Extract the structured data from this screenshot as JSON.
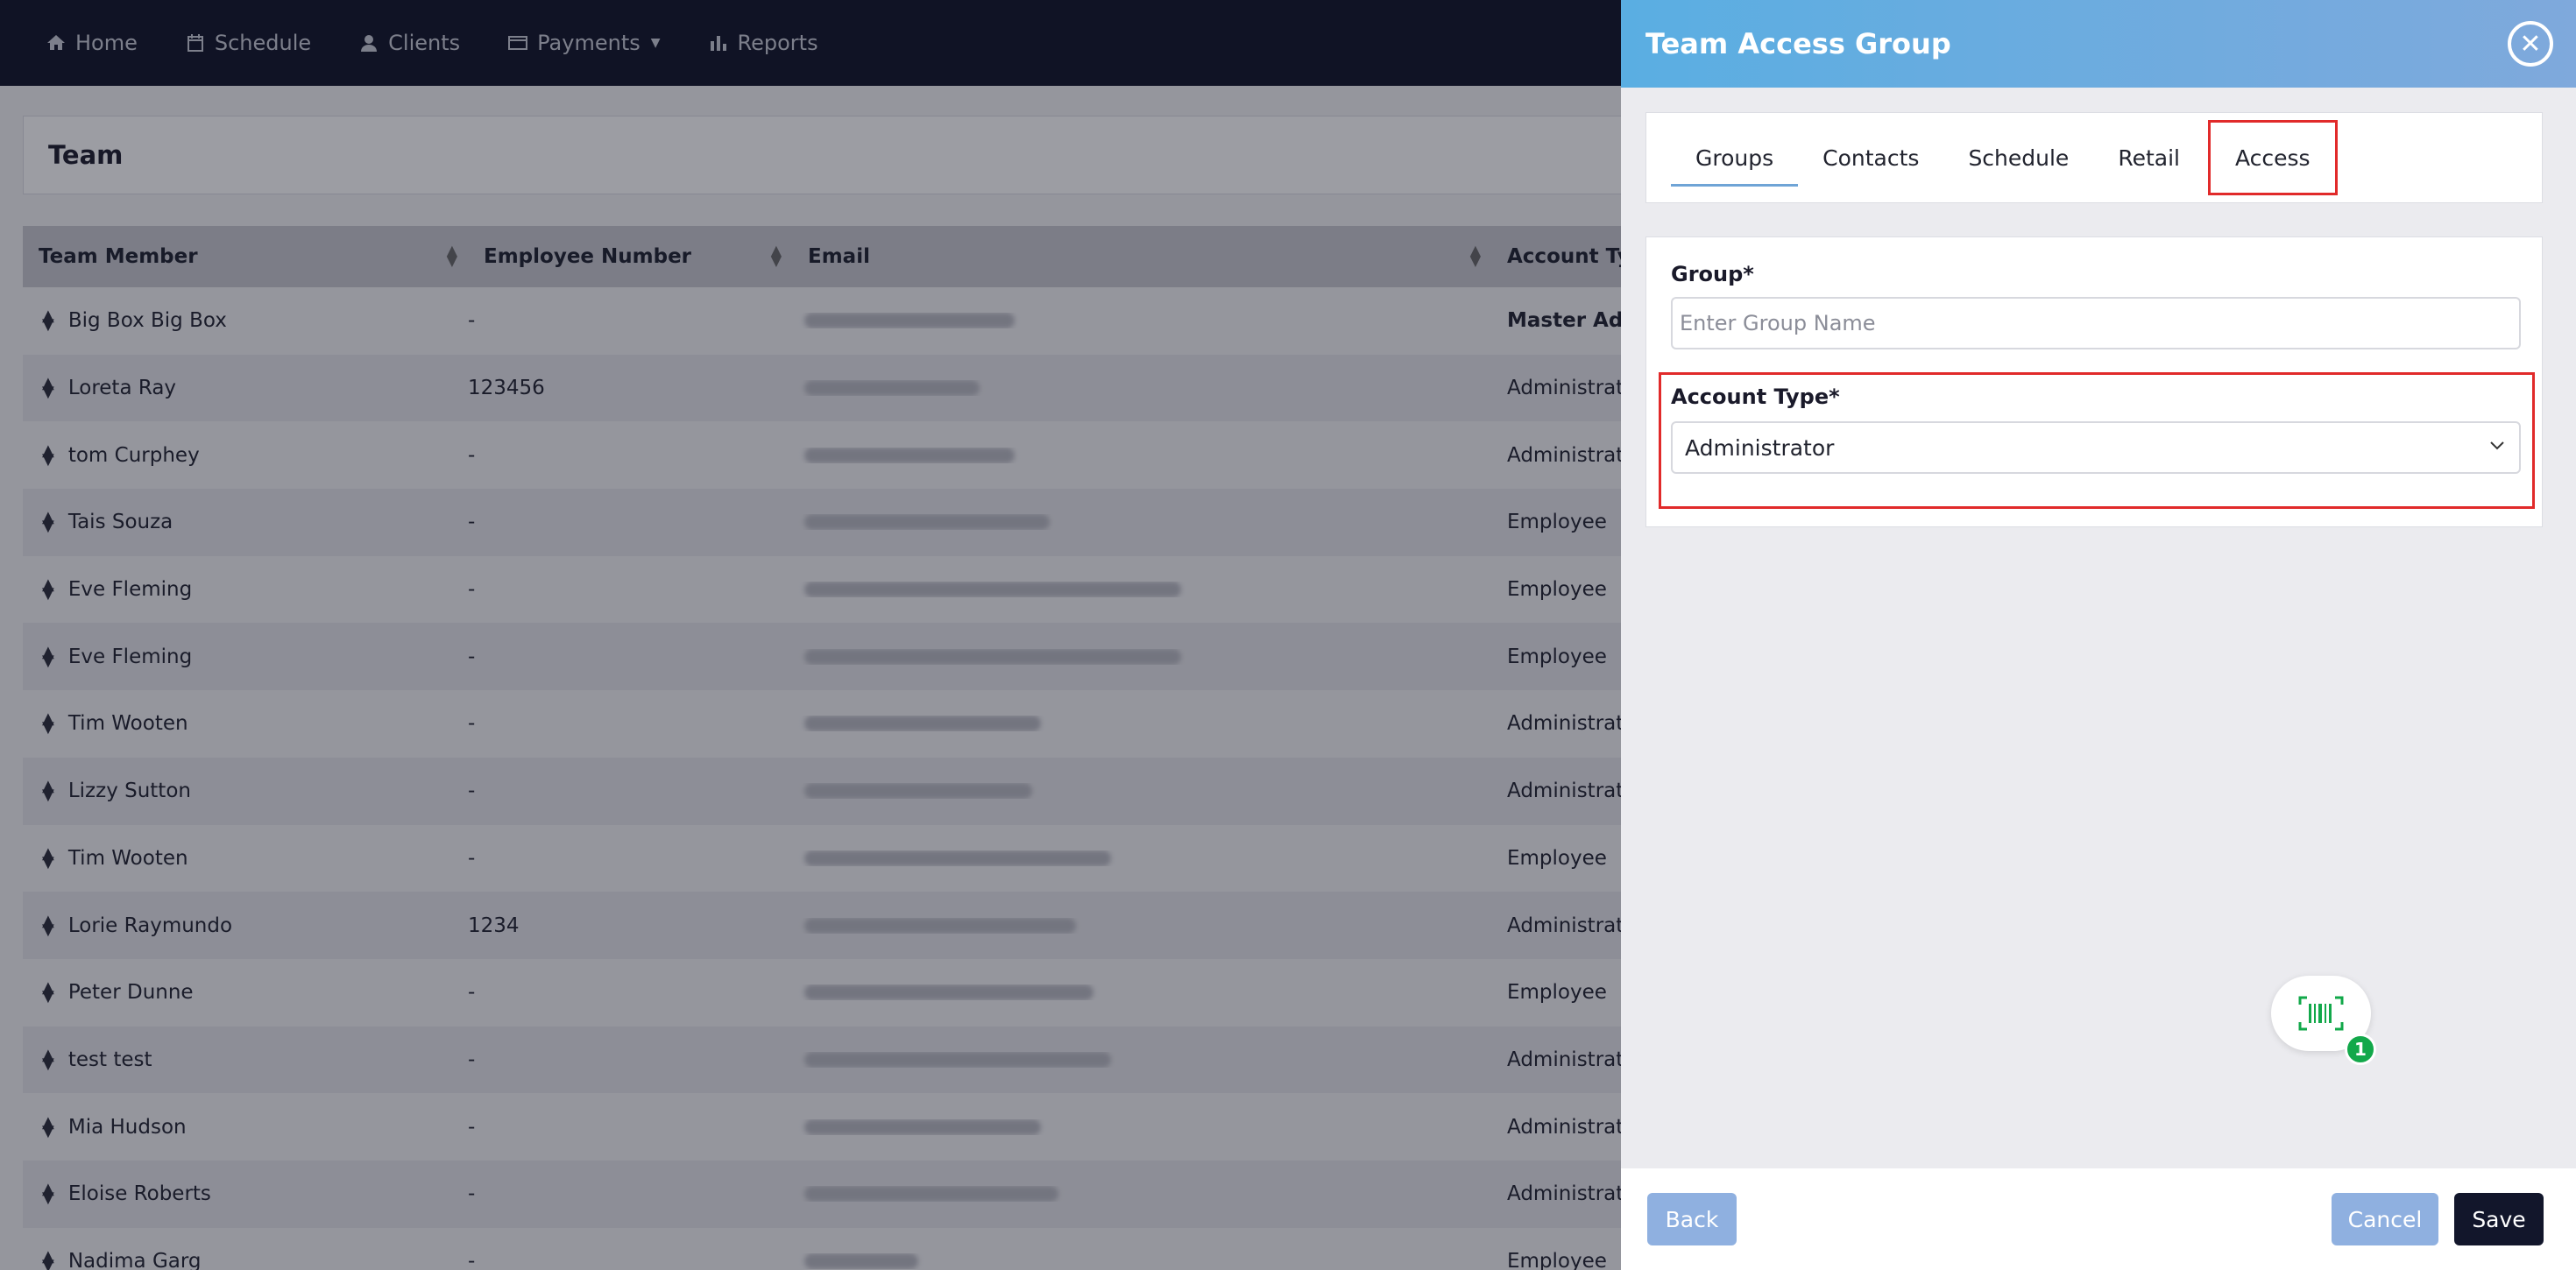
{
  "nav": {
    "items": [
      {
        "label": "Home",
        "icon": "home-icon"
      },
      {
        "label": "Schedule",
        "icon": "calendar-icon"
      },
      {
        "label": "Clients",
        "icon": "user-icon"
      },
      {
        "label": "Payments",
        "icon": "credit-card-icon",
        "has_dropdown": true
      },
      {
        "label": "Reports",
        "icon": "bar-chart-icon"
      }
    ]
  },
  "team": {
    "title": "Team",
    "columns": [
      "Team Member",
      "Employee Number",
      "Email",
      "Account Typ"
    ],
    "rows": [
      {
        "name": "Big Box Big Box",
        "number": "-",
        "type": "Master Adm",
        "type_bold": true
      },
      {
        "name": "Loreta Ray",
        "number": "123456",
        "type": "Administrato"
      },
      {
        "name": "tom Curphey",
        "number": "-",
        "type": "Administrato"
      },
      {
        "name": "Tais Souza",
        "number": "-",
        "type": "Employee"
      },
      {
        "name": "Eve Fleming",
        "number": "-",
        "type": "Employee"
      },
      {
        "name": "Eve Fleming",
        "number": "-",
        "type": "Employee"
      },
      {
        "name": "Tim Wooten",
        "number": "-",
        "type": "Administrato"
      },
      {
        "name": "Lizzy Sutton",
        "number": "-",
        "type": "Administrato"
      },
      {
        "name": "Tim Wooten",
        "number": "-",
        "type": "Employee"
      },
      {
        "name": "Lorie Raymundo",
        "number": "1234",
        "type": "Administrato"
      },
      {
        "name": "Peter Dunne",
        "number": "-",
        "type": "Employee"
      },
      {
        "name": "test test",
        "number": "-",
        "type": "Administrato"
      },
      {
        "name": "Mia Hudson",
        "number": "-",
        "type": "Administrato"
      },
      {
        "name": "Eloise Roberts",
        "number": "-",
        "type": "Administrato"
      },
      {
        "name": "Nadima Garg",
        "number": "-",
        "type": "Employee"
      }
    ]
  },
  "panel": {
    "title": "Team Access Group",
    "tabs": [
      "Groups",
      "Contacts",
      "Schedule",
      "Retail",
      "Access"
    ],
    "active_tab": "Groups",
    "group_label": "Group*",
    "group_placeholder": "Enter Group Name",
    "account_type_label": "Account Type*",
    "account_type_value": "Administrator",
    "barcode_badge": "1",
    "back_label": "Back",
    "cancel_label": "Cancel",
    "save_label": "Save"
  },
  "colors": {
    "nav_bg": "#0f1226",
    "header_gradient_start": "#5aaee2",
    "header_gradient_end": "#7fa9dc",
    "highlight_red": "#e12a2a",
    "save_bg": "#12162b",
    "badge_green": "#12a84a"
  }
}
